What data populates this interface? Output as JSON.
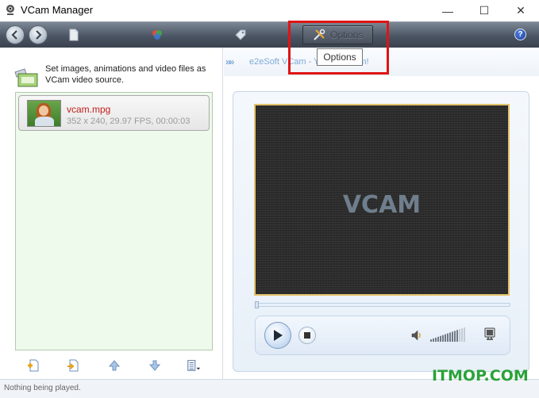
{
  "window": {
    "title": "VCam Manager",
    "minimize": "—",
    "maximize": "☐",
    "close": "✕"
  },
  "toolbar": {
    "options_label": "Options",
    "help_label": "?"
  },
  "tooltip": {
    "text": "Options"
  },
  "left": {
    "info_text": "Set images, animations and video files as VCam video source.",
    "files": [
      {
        "name": "vcam.mpg",
        "meta": "352 x 240, 29.97 FPS, 00:00:03"
      }
    ]
  },
  "right": {
    "banner_arrows": "»»",
    "banner_text": "e2eSoft VCam - Y                  ed webcam!",
    "video_logo": "VCAM",
    "volume_level": 0.75
  },
  "status": {
    "text": "Nothing being played."
  },
  "watermark": {
    "text": "ITMOP.COM"
  },
  "colors": {
    "accent_red": "#e01414",
    "file_name": "#c0211b",
    "banner": "#7fa9d8",
    "watermark": "#2aa23a",
    "list_bg": "#eefaeb"
  }
}
